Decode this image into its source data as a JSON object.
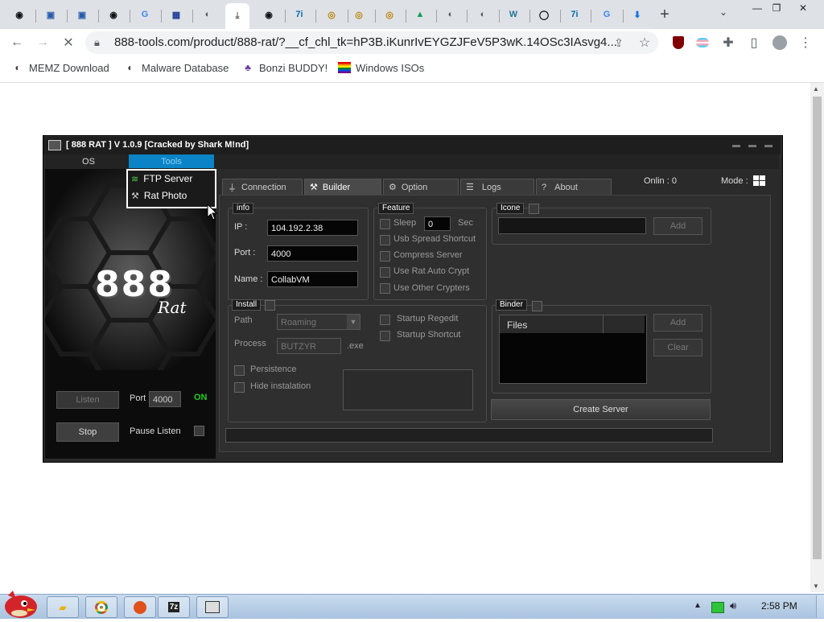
{
  "browser": {
    "tabs": [
      {
        "icon": "github-icon",
        "glyph": "◉"
      },
      {
        "icon": "app-icon",
        "glyph": "▣"
      },
      {
        "icon": "app-icon",
        "glyph": "▣"
      },
      {
        "icon": "github-icon",
        "glyph": "◉"
      },
      {
        "icon": "google-icon",
        "glyph": "G"
      },
      {
        "icon": "ide-icon",
        "glyph": "▦"
      },
      {
        "icon": "globe-icon",
        "glyph": "◐"
      },
      {
        "icon": "active-tab-icon",
        "glyph": "⤓"
      },
      {
        "icon": "github-icon",
        "glyph": "◉"
      },
      {
        "icon": "7zip-icon",
        "glyph": "7i"
      },
      {
        "icon": "seal-icon",
        "glyph": "◎"
      },
      {
        "icon": "seal-icon",
        "glyph": "◎"
      },
      {
        "icon": "seal-icon",
        "glyph": "◎"
      },
      {
        "icon": "drive-icon",
        "glyph": "▲"
      },
      {
        "icon": "globe-icon",
        "glyph": "◐"
      },
      {
        "icon": "globe-icon",
        "glyph": "◐"
      },
      {
        "icon": "wordpress-icon",
        "glyph": "W"
      },
      {
        "icon": "circle-app-icon",
        "glyph": "◯"
      },
      {
        "icon": "7zip-icon",
        "glyph": "7i"
      },
      {
        "icon": "google-icon",
        "glyph": "G"
      },
      {
        "icon": "download-icon",
        "glyph": "⬇"
      }
    ],
    "new_tab": "+",
    "url": "888-tools.com/product/888-rat/?__cf_chl_tk=hP3B.iKunrIvEYGZJFeV5P3wK.14OSc3IAsvg4...",
    "bookmarks": [
      {
        "label": "MEMZ Download",
        "icon": "globe-icon"
      },
      {
        "label": "Malware Database",
        "icon": "globe-icon"
      },
      {
        "label": "Bonzi BUDDY!",
        "icon": "bonzi-icon"
      },
      {
        "label": "Windows ISOs",
        "icon": "windows-flag-icon"
      }
    ]
  },
  "app": {
    "title": "[ 888 RAT ] V 1.0.9 [Cracked by Shark M!nd]",
    "menu": {
      "os": "OS",
      "tools": "Tools"
    },
    "dropdown": {
      "ftp": "FTP Server",
      "rat_photo": "Rat Photo"
    },
    "logo": {
      "number": "888",
      "sub": "Rat"
    },
    "left": {
      "listen": "Listen",
      "port_label": "Port",
      "port_value": "4000",
      "status": "ON",
      "stop": "Stop",
      "pause": "Pause Listen"
    },
    "online": "Onlin : 0",
    "mode": "Mode :",
    "tabs": {
      "connection": "Connection",
      "builder": "Builder",
      "option": "Option",
      "logs": "Logs",
      "about": "About"
    },
    "info": {
      "title": "info",
      "ip_label": "IP :",
      "ip": "104.192.2.38",
      "port_label": "Port :",
      "port": "4000",
      "name_label": "Name :",
      "name": "CollabVM"
    },
    "feature": {
      "title": "Feature",
      "sleep": "Sleep",
      "sleep_value": "0",
      "sec": "Sec",
      "usb": "Usb Spread Shortcut",
      "compress": "Compress Server",
      "autocrypt": "Use Rat Auto Crypt",
      "other": "Use Other Crypters"
    },
    "icone": {
      "title": "Icone",
      "add": "Add"
    },
    "install": {
      "title": "Install",
      "path_label": "Path",
      "path_value": "Roaming",
      "process_label": "Process",
      "process_value": "BUTZYR",
      "ext": ".exe",
      "persistence": "Persistence",
      "hide": "Hide instalation",
      "regedit": "Startup Regedit",
      "shortcut": "Startup Shortcut"
    },
    "binder": {
      "title": "Binder",
      "files": "Files",
      "add": "Add",
      "clear": "Clear"
    },
    "create": "Create Server"
  },
  "taskbar": {
    "time": "2:58 PM"
  }
}
